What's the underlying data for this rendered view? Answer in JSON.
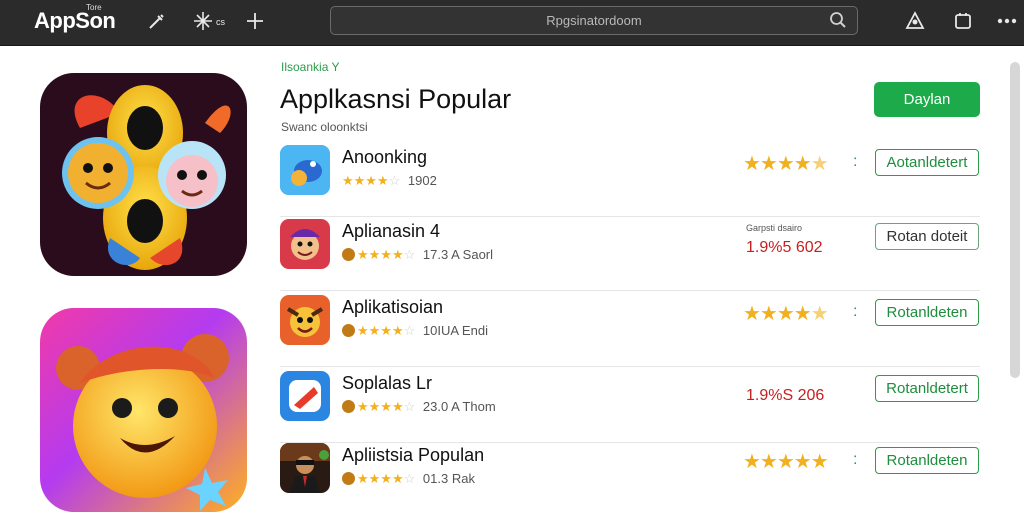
{
  "topbar": {
    "logo": "AppSon",
    "logo_sup": "Tore",
    "tool_icons": [
      "pen-tool-icon",
      "sparkle-icon",
      "plus-icon"
    ],
    "search_placeholder": "Rpgsinatordoom",
    "right_icons": [
      "user-icon",
      "window-icon",
      "more-icon"
    ]
  },
  "page": {
    "breadcrumb": "Ilsoankia Y",
    "title": "Applkasnsi Popular",
    "subtitle": "Swanc oloonktsi",
    "primary_button": "Daylan"
  },
  "apps": [
    {
      "name": "Anoonking",
      "rating_text": "1902",
      "stars": 4,
      "meta_prefix": "",
      "right": "stars",
      "right_stars": 4.5,
      "button": "Aotanldetert",
      "button_style": "green"
    },
    {
      "name": "Aplianasin 4",
      "rating_text": "17.3 A Saorl",
      "stars": 4,
      "meta_prefix": "coin",
      "right": "price",
      "price_small": "Garpsti dsairo",
      "price": "1.9%5 602",
      "button": "Rotan doteit",
      "button_style": "neutral"
    },
    {
      "name": "Aplikatisoian",
      "rating_text": "10IUA Endi",
      "stars": 4,
      "meta_prefix": "coin",
      "right": "stars",
      "right_stars": 4.5,
      "button": "Rotanldeten",
      "button_style": "green"
    },
    {
      "name": "Soplalas Lr",
      "rating_text": "23.0 A Thom",
      "stars": 4,
      "meta_prefix": "coin",
      "right": "price",
      "price_small": "",
      "price": "1.9%S 206",
      "button": "Rotanldetert",
      "button_style": "green"
    },
    {
      "name": "Apliistsia Populan",
      "rating_text": "01.3 Rak",
      "stars": 4,
      "meta_prefix": "coin",
      "right": "stars",
      "right_stars": 5,
      "button": "Rotanldeten",
      "button_style": "green"
    }
  ],
  "colors": {
    "accent_green": "#1daa4a",
    "star_gold": "#f2b01e",
    "price_red": "#c81e1e",
    "topbar": "#2b2b2b"
  }
}
